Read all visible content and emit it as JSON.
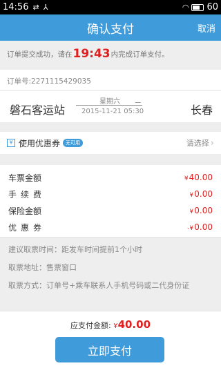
{
  "status_bar": {
    "time": "14:56",
    "battery": "60"
  },
  "header": {
    "title": "确认支付",
    "cancel": "取消"
  },
  "notice": {
    "prefix": "订单提交成功，请在",
    "countdown": "19:43",
    "suffix": "内完成订单支付。"
  },
  "order": {
    "order_no": "订单号:2271115429035",
    "from": "磐石客运站",
    "to": "长春",
    "weekday": "星期六",
    "depart": "2015-11-21 05:30"
  },
  "coupon": {
    "label": "使用优惠券",
    "badge": "无可用",
    "select": "请选择"
  },
  "amounts": [
    {
      "label": "车票金额",
      "yen": "¥",
      "value": "40.00"
    },
    {
      "label": "手续费",
      "yen": "¥",
      "value": "0.00"
    },
    {
      "label": "保险金额",
      "yen": "¥",
      "value": "0.00"
    },
    {
      "label": "优惠券",
      "yen": "-¥",
      "value": "0.00"
    }
  ],
  "info": [
    "建议取票时间：距发车时间提前1个小时",
    "取票地址：售票窗口",
    "取票方式：订单号+乘车联系人手机号码或二代身份证"
  ],
  "payment": {
    "label": "应支付金额:",
    "yen": "¥",
    "amount": "40.00",
    "button": "立即支付"
  },
  "colors": {
    "accent": "#3f9bd9",
    "price": "#e02020"
  }
}
